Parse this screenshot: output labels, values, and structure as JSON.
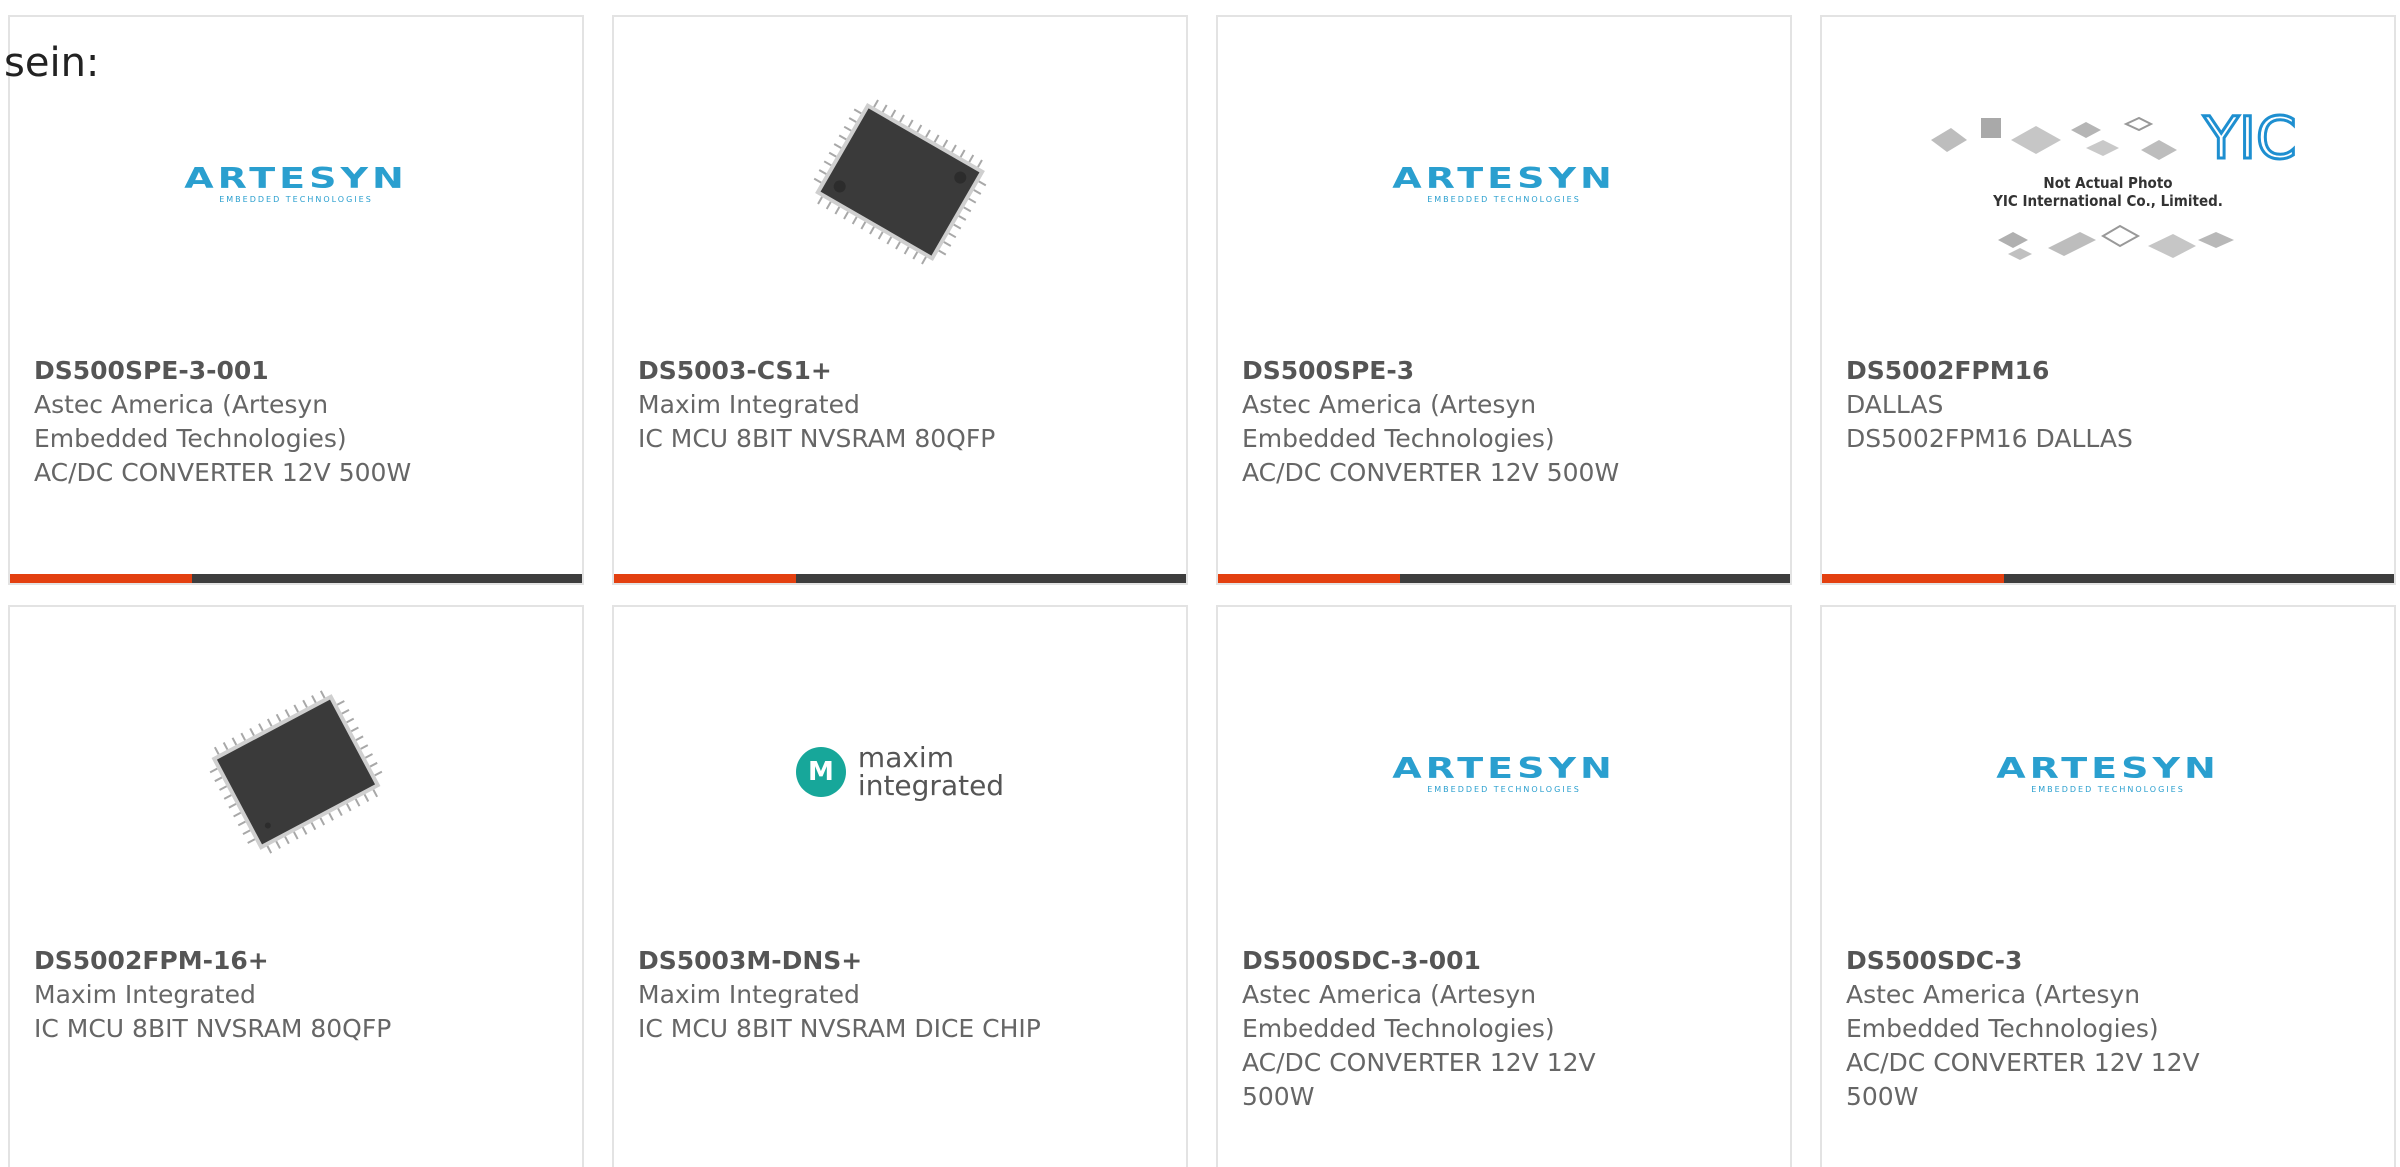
{
  "intro_text": "sein:",
  "colors": {
    "accent": "#e34010",
    "bar": "#3d3d3d",
    "artesyn_blue": "#2a9fcf",
    "maxim_teal": "#17a79a"
  },
  "logos": {
    "artesyn": {
      "name": "ARTESYN",
      "tagline": "EMBEDDED TECHNOLOGIES"
    },
    "maxim": {
      "mark": "M",
      "line1": "maxim",
      "line2": "integrated"
    },
    "yic": {
      "mark": "YIC",
      "caption1": "Not Actual Photo",
      "caption2": "YIC International Co., Limited."
    }
  },
  "products": [
    {
      "part": "DS500SPE-3-001",
      "mfr1": "Astec America (Artesyn",
      "mfr2": "Embedded Technologies)",
      "desc1": "AC/DC CONVERTER 12V 500W",
      "desc2": "",
      "image": "artesyn-logo"
    },
    {
      "part": "DS5003-CS1+",
      "mfr1": "Maxim Integrated",
      "mfr2": "",
      "desc1": "IC MCU 8BIT NVSRAM 80QFP",
      "desc2": "",
      "image": "qfp-chip-photo"
    },
    {
      "part": "DS500SPE-3",
      "mfr1": "Astec America (Artesyn",
      "mfr2": "Embedded Technologies)",
      "desc1": "AC/DC CONVERTER 12V 500W",
      "desc2": "",
      "image": "artesyn-logo"
    },
    {
      "part": "DS5002FPM16",
      "mfr1": "DALLAS",
      "mfr2": "",
      "desc1": "DS5002FPM16 DALLAS",
      "desc2": "",
      "image": "yic-placeholder"
    },
    {
      "part": "DS5002FPM-16+",
      "mfr1": "Maxim Integrated",
      "mfr2": "",
      "desc1": "IC MCU 8BIT NVSRAM 80QFP",
      "desc2": "",
      "image": "qfp-chip-photo"
    },
    {
      "part": "DS5003M-DNS+",
      "mfr1": "Maxim Integrated",
      "mfr2": "",
      "desc1": "IC MCU 8BIT NVSRAM DICE CHIP",
      "desc2": "",
      "image": "maxim-logo"
    },
    {
      "part": "DS500SDC-3-001",
      "mfr1": "Astec America (Artesyn",
      "mfr2": "Embedded Technologies)",
      "desc1": "AC/DC CONVERTER 12V 12V",
      "desc2": "500W",
      "image": "artesyn-logo"
    },
    {
      "part": "DS500SDC-3",
      "mfr1": "Astec America (Artesyn",
      "mfr2": "Embedded Technologies)",
      "desc1": "AC/DC CONVERTER 12V 12V",
      "desc2": "500W",
      "image": "artesyn-logo"
    }
  ]
}
